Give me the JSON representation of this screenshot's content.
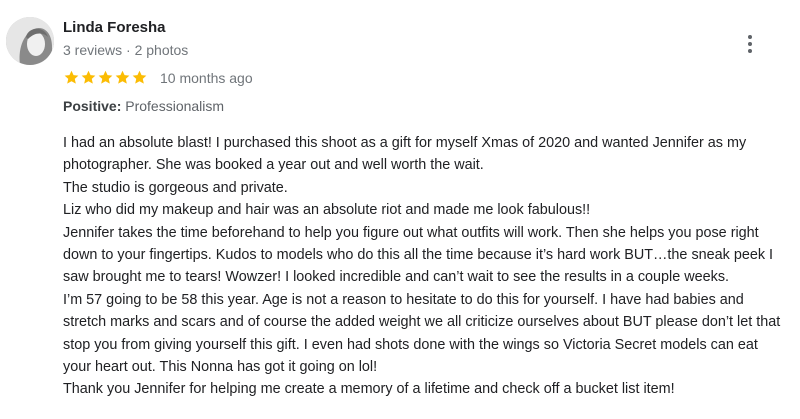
{
  "reviewer": {
    "name": "Linda Foresha",
    "meta": "3 reviews · 2 photos"
  },
  "rating": {
    "stars": 5,
    "max": 5,
    "star_color": "#fbbc04",
    "date": "10 months ago"
  },
  "highlight": {
    "label": "Positive:",
    "value": "Professionalism"
  },
  "review": {
    "lines": [
      "I had an absolute blast! I purchased this shoot as a gift for myself Xmas of 2020 and wanted Jennifer as my photographer. She was booked a year out and well worth the wait.",
      "The studio is gorgeous and private.",
      "Liz who did my makeup and hair was an absolute riot and made me look fabulous!!",
      "Jennifer takes the time beforehand to help you figure out what outfits will work. Then she helps you pose right down to your fingertips. Kudos to models who do this all the time because it’s hard work BUT…the sneak peek I saw brought me to tears! Wowzer! I looked incredible and can’t wait to see the results in a couple weeks.",
      "I’m 57 going to be 58 this year. Age is not a reason to hesitate to do this for yourself. I have had babies and stretch marks and scars and of course the added weight we all criticize ourselves about BUT please don’t let that stop you from giving yourself this gift. I even had shots done with the wings so Victoria Secret models can eat your heart out. This Nonna has got it going on lol!",
      "Thank you Jennifer for helping me create a memory of a lifetime and check off a bucket list item!"
    ]
  },
  "icons": {
    "more": "more-vert-icon",
    "star": "star-icon",
    "avatar": "profile-photo"
  }
}
